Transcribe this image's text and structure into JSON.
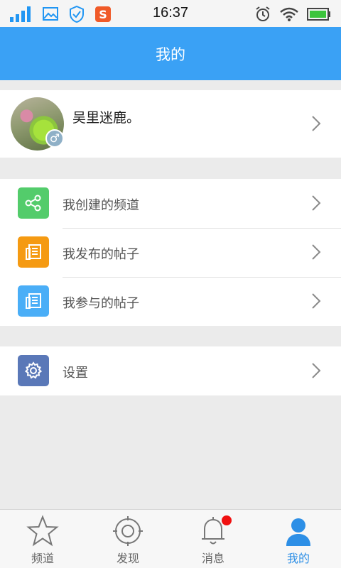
{
  "status_bar": {
    "time": "16:37",
    "icons_left": [
      "signal-icon",
      "image-icon",
      "shield-icon",
      "sogou-icon"
    ],
    "icons_right": [
      "alarm-icon",
      "wifi-icon",
      "battery-icon"
    ]
  },
  "header": {
    "title": "我的"
  },
  "profile": {
    "username": "吴里迷鹿。",
    "gender_symbol": "♂"
  },
  "menu_group_1": [
    {
      "label": "我创建的频道",
      "icon": "share-icon",
      "color": "#53cc6b"
    },
    {
      "label": "我发布的帖子",
      "icon": "document-icon",
      "color": "#f59a12"
    },
    {
      "label": "我参与的帖子",
      "icon": "document-icon",
      "color": "#4aaef7"
    }
  ],
  "menu_group_2": [
    {
      "label": "设置",
      "icon": "gear-icon",
      "color": "#5a78b8"
    }
  ],
  "tabbar": {
    "tabs": [
      {
        "label": "频道",
        "icon": "star-icon"
      },
      {
        "label": "发现",
        "icon": "target-icon"
      },
      {
        "label": "消息",
        "icon": "bell-icon",
        "badge": true
      },
      {
        "label": "我的",
        "icon": "person-icon",
        "active": true
      }
    ]
  },
  "colors": {
    "accent": "#3aa1f5",
    "active_tab": "#2d8fe6",
    "badge": "#f01010"
  }
}
